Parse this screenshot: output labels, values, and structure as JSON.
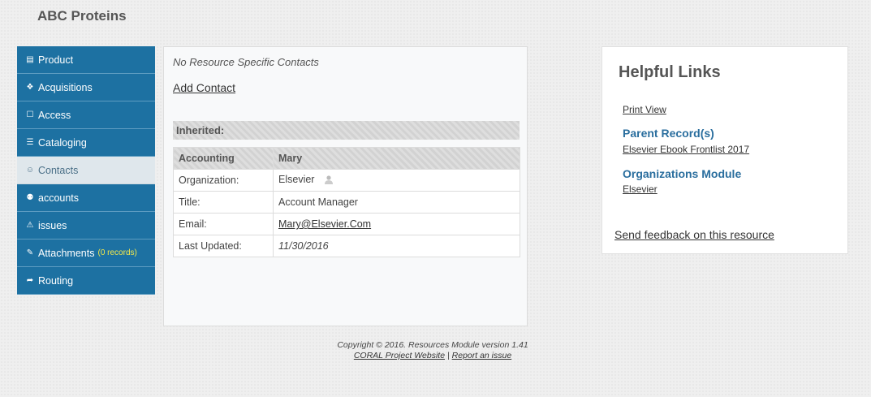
{
  "header": {
    "title": "ABC Proteins"
  },
  "sidebar": {
    "items": [
      {
        "label": "Product",
        "icon": "book-icon",
        "glyph": "▤"
      },
      {
        "label": "Acquisitions",
        "icon": "sitemap-icon",
        "glyph": "❖"
      },
      {
        "label": "Access",
        "icon": "unlock-icon",
        "glyph": "☐"
      },
      {
        "label": "Cataloging",
        "icon": "list-icon",
        "glyph": "☰"
      },
      {
        "label": "Contacts",
        "icon": "user-plus-icon",
        "glyph": "☺"
      },
      {
        "label": "accounts",
        "icon": "users-icon",
        "glyph": "⚉"
      },
      {
        "label": "issues",
        "icon": "warning-icon",
        "glyph": "⚠"
      },
      {
        "label": "Attachments",
        "icon": "paperclip-icon",
        "glyph": "✎",
        "count": "(0 records)"
      },
      {
        "label": "Routing",
        "icon": "share-icon",
        "glyph": "➦"
      }
    ],
    "active": "Contacts"
  },
  "main": {
    "no_contacts": "No Resource Specific Contacts",
    "add_contact": "Add Contact",
    "inherited_label": "Inherited:",
    "contact": {
      "header_left": "Accounting",
      "header_right": "Mary",
      "rows": [
        {
          "label": "Organization:",
          "value": "Elsevier"
        },
        {
          "label": "Title:",
          "value": "Account Manager"
        },
        {
          "label": "Email:",
          "value": "Mary@Elsevier.Com"
        },
        {
          "label": "Last Updated:",
          "value": "11/30/2016"
        }
      ]
    }
  },
  "helpful": {
    "title": "Helpful Links",
    "print_view": "Print View",
    "parent_heading": "Parent Record(s)",
    "parent_link": "Elsevier Ebook Frontlist 2017",
    "org_heading": "Organizations Module",
    "org_link": "Elsevier",
    "feedback": "Send feedback on this resource"
  },
  "footer": {
    "copyright": "Copyright © 2016. Resources Module version 1.41",
    "website_link": "CORAL Project Website",
    "separator": "|",
    "report_link": "Report an issue"
  },
  "colors": {
    "sidebar_bg": "#1d71a2",
    "sidebar_active_bg": "#dfe7ec",
    "link_heading": "#2a6e9e",
    "count_text": "#f4e94a"
  }
}
